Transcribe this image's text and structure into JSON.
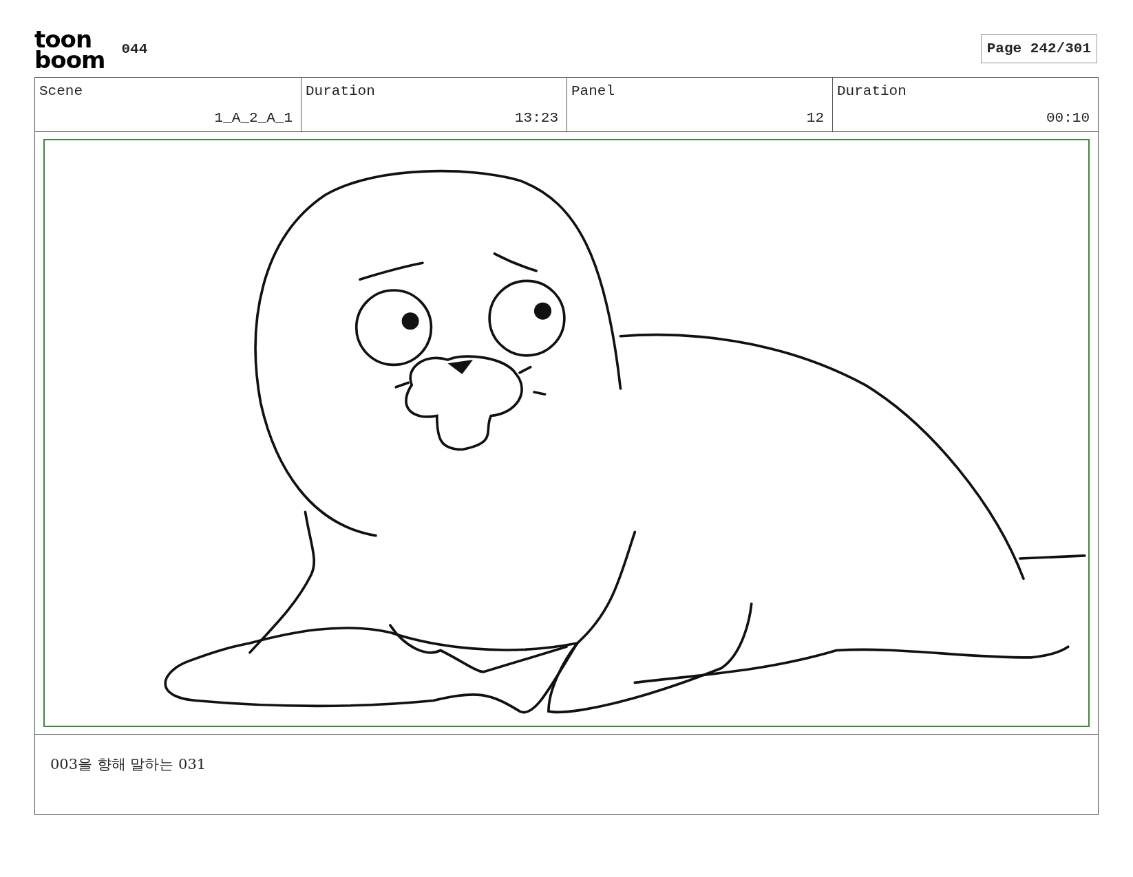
{
  "logo": {
    "lines": [
      "toon",
      "boom"
    ]
  },
  "sequence": "044",
  "page": "Page 242/301",
  "fields": [
    {
      "label": "Scene",
      "value": "1_A_2_A_1"
    },
    {
      "label": "Duration",
      "value": "13:23"
    },
    {
      "label": "Panel",
      "value": "12"
    },
    {
      "label": "Duration",
      "value": "00:10"
    }
  ],
  "panel": {
    "kind": "seal"
  },
  "caption": "003을 향해 말하는 031"
}
